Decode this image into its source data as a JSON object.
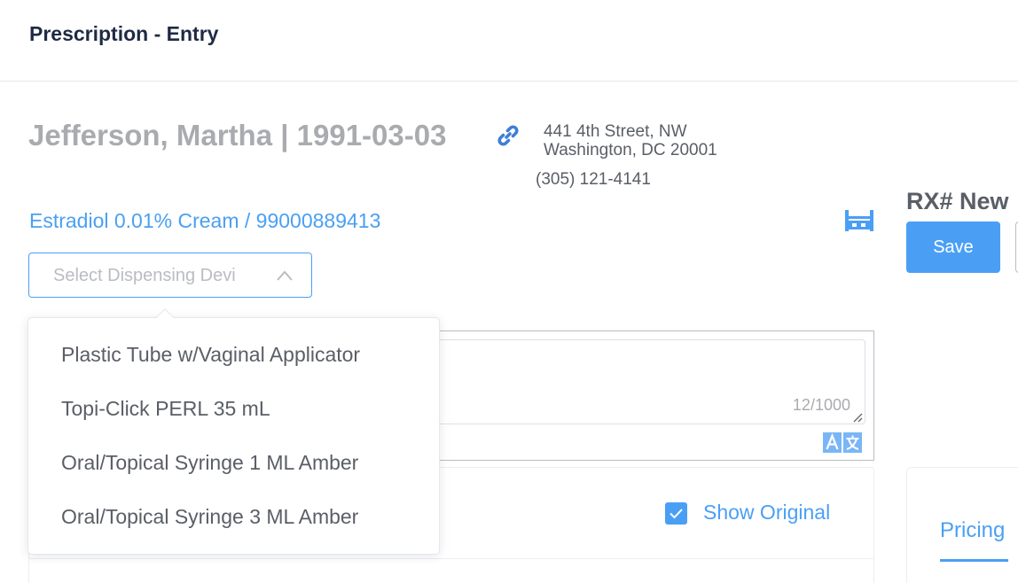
{
  "header": {
    "title": "Prescription - Entry"
  },
  "patient": {
    "name": "Jefferson, Martha | 1991-03-03",
    "address_line1": "441 4th Street, NW",
    "address_line2": "Washington, DC 20001",
    "phone": "(305) 121-4141"
  },
  "drug": {
    "label": "Estradiol 0.01% Cream / 99000889413"
  },
  "rx": {
    "label": "RX# New",
    "save_label": "Save"
  },
  "dispensing_select": {
    "placeholder": "Select Dispensing Devi",
    "options": [
      "Plastic Tube w/Vaginal Applicator",
      "Topi-Click PERL 35 mL",
      "Oral/Topical Syringe 1 ML Amber",
      "Oral/Topical Syringe 3 ML Amber"
    ]
  },
  "notes": {
    "char_count": "12/1000"
  },
  "options": {
    "show_original_label": "Show Original",
    "show_original_checked": true
  },
  "tabs": {
    "pricing_label": "Pricing"
  },
  "colors": {
    "accent": "#4a9ff5",
    "muted_text": "#a9abaf",
    "title": "#1f2a44"
  },
  "icons": [
    "link-icon",
    "dispensing-device-icon",
    "chevron-up-icon",
    "translate-icon",
    "checkbox-checked-icon",
    "resize-grip-icon"
  ]
}
